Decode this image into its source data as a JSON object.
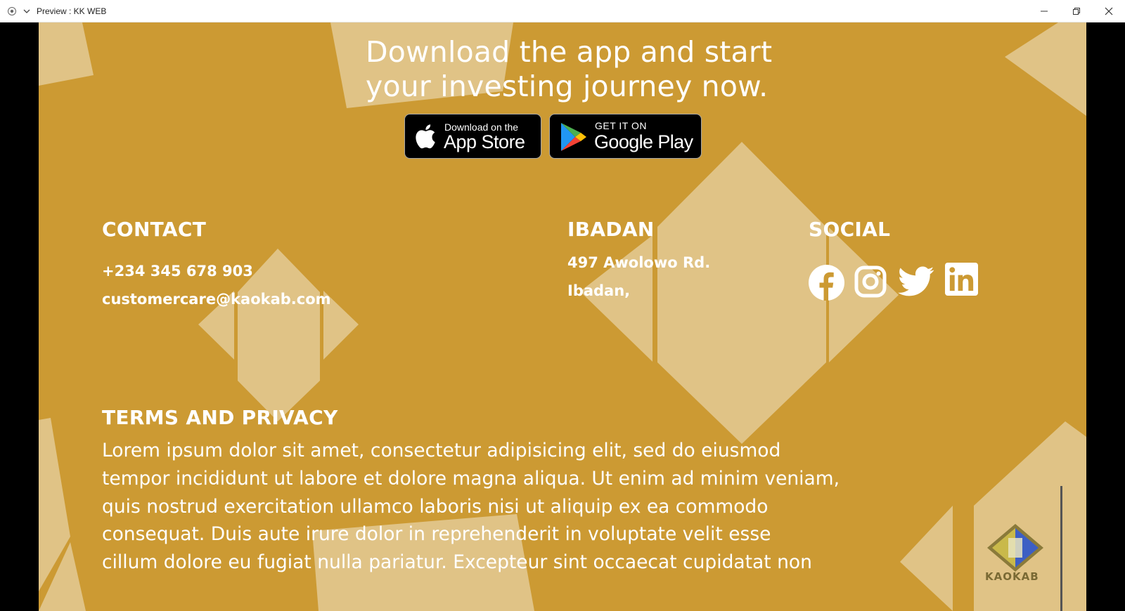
{
  "window": {
    "title": "Preview : KK WEB"
  },
  "hero": {
    "line1": "Download the app and start",
    "line2": "your investing journey now."
  },
  "app_store": {
    "small": "Download on the",
    "big": "App Store"
  },
  "google_play": {
    "small": "GET IT ON",
    "big": "Google Play"
  },
  "contact": {
    "heading": "CONTACT",
    "phone": "+234 345 678 903",
    "email": "customercare@kaokab.com"
  },
  "ibadan": {
    "heading": "IBADAN",
    "address1": "497 Awolowo Rd.",
    "address2": "Ibadan,"
  },
  "social": {
    "heading": "SOCIAL",
    "icons": [
      "facebook-icon",
      "instagram-icon",
      "twitter-icon",
      "linkedin-icon"
    ]
  },
  "terms": {
    "heading": "TERMS AND PRIVACY",
    "lines": [
      "Lorem ipsum dolor sit amet, consectetur adipisicing elit, sed do eiusmod",
      "tempor incididunt ut labore et dolore magna aliqua. Ut enim ad minim veniam,",
      "quis nostrud exercitation ullamco laboris nisi ut aliquip ex ea commodo",
      "consequat. Duis aute irure dolor in reprehenderit in voluptate velit esse",
      "cillum dolore eu fugiat nulla pariatur. Excepteur sint occaecat cupidatat non"
    ]
  },
  "logo": {
    "text": "KAOKAB"
  },
  "colors": {
    "background": "#cc9a33",
    "shape": "#e0c386",
    "text": "#ffffff"
  }
}
